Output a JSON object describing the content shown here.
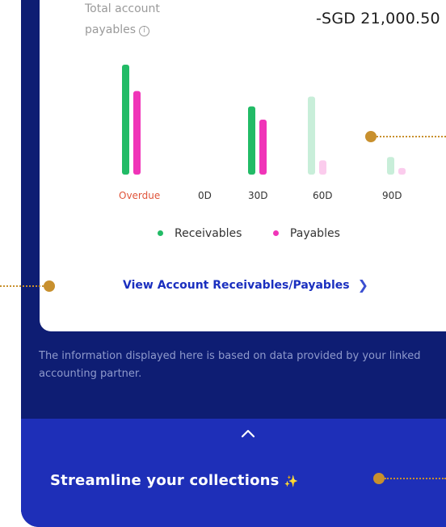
{
  "summary": {
    "total_label_line1": "Total account",
    "total_label_line2": "payables",
    "info_icon": "info-icon",
    "total_value": "-SGD 21,000.50"
  },
  "chart_data": {
    "type": "bar",
    "categories": [
      "Overdue",
      "0D",
      "30D",
      "60D",
      "90D"
    ],
    "series": [
      {
        "name": "Receivables",
        "values": [
          100,
          0,
          62,
          71,
          16
        ],
        "color": "#22bb66"
      },
      {
        "name": "Payables",
        "values": [
          76,
          0,
          50,
          13,
          6
        ],
        "color": "#f034b8"
      }
    ],
    "overdue_label_color": "#e0543a",
    "faded_categories": [
      "60D",
      "90D"
    ],
    "ylim": [
      0,
      100
    ],
    "grid": false,
    "legend_position": "bottom"
  },
  "legend": {
    "receivables": "Receivables",
    "payables": "Payables"
  },
  "link": {
    "label": "View Account Receivables/Payables",
    "chevron_icon": "chevron-right-icon"
  },
  "disclaimer": "The information displayed here is based on data provided by your linked accounting partner.",
  "collections": {
    "caret_icon": "chevron-up-icon",
    "title": "Streamline your collections",
    "sparkle_icon": "sparkle-icon"
  },
  "colors": {
    "background_navy": "#0e1d73",
    "collections_blue": "#1e2fb8",
    "link_blue": "#1a2fbf",
    "callout_gold": "#c8902e"
  }
}
